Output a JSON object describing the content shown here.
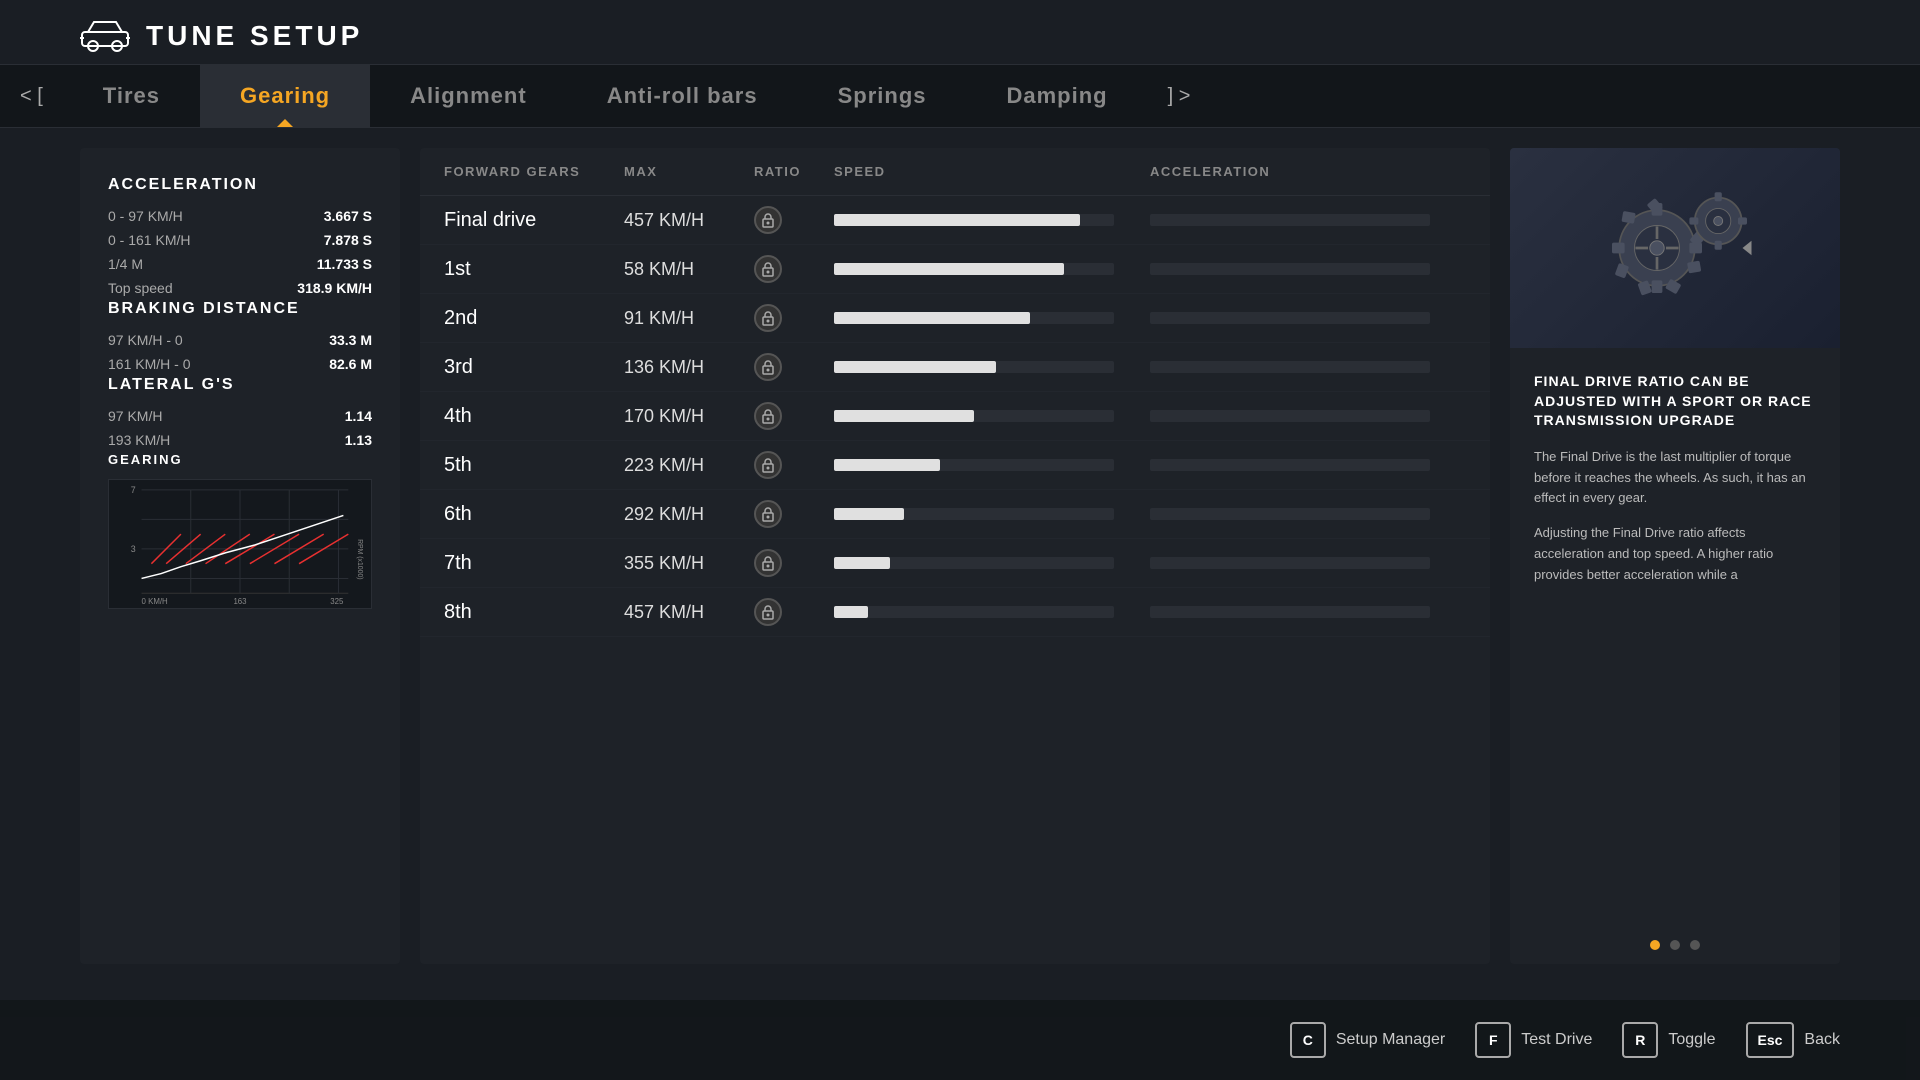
{
  "header": {
    "title": "TUNE SETUP"
  },
  "tabs": {
    "nav_left": "< [",
    "nav_right": "] >",
    "items": [
      {
        "id": "tires",
        "label": "Tires",
        "active": false
      },
      {
        "id": "gearing",
        "label": "Gearing",
        "active": true
      },
      {
        "id": "alignment",
        "label": "Alignment",
        "active": false
      },
      {
        "id": "antiroll",
        "label": "Anti-roll bars",
        "active": false
      },
      {
        "id": "springs",
        "label": "Springs",
        "active": false
      },
      {
        "id": "damping",
        "label": "Damping",
        "active": false
      }
    ]
  },
  "left_panel": {
    "sections": [
      {
        "title": "ACCELERATION",
        "rows": [
          {
            "label": "0 - 97 KM/H",
            "value": "3.667 S"
          },
          {
            "label": "0 - 161 KM/H",
            "value": "7.878 S"
          },
          {
            "label": "1/4 M",
            "value": "11.733 S"
          },
          {
            "label": "Top speed",
            "value": "318.9 KM/H"
          }
        ]
      },
      {
        "title": "BRAKING DISTANCE",
        "rows": [
          {
            "label": "97 KM/H - 0",
            "value": "33.3 M"
          },
          {
            "label": "161 KM/H - 0",
            "value": "82.6 M"
          }
        ]
      },
      {
        "title": "LATERAL G'S",
        "rows": [
          {
            "label": "97 KM/H",
            "value": "1.14"
          },
          {
            "label": "193 KM/H",
            "value": "1.13"
          }
        ]
      }
    ],
    "gearing_title": "GEARING",
    "chart": {
      "y_max": "7",
      "y_min": "3",
      "x_labels": [
        "0 KM/H",
        "163",
        "325"
      ],
      "rpm_label": "RPM (x1000)"
    }
  },
  "gearing_table": {
    "headers": [
      "FORWARD GEARS",
      "MAX",
      "RATIO",
      "SPEED",
      "ACCELERATION"
    ],
    "rows": [
      {
        "name": "Final drive",
        "max": "457 KM/H",
        "speed_pct": 88,
        "accel_pct": 0
      },
      {
        "name": "1st",
        "max": "58 KM/H",
        "speed_pct": 82,
        "accel_pct": 0
      },
      {
        "name": "2nd",
        "max": "91 KM/H",
        "speed_pct": 70,
        "accel_pct": 0
      },
      {
        "name": "3rd",
        "max": "136 KM/H",
        "speed_pct": 58,
        "accel_pct": 0
      },
      {
        "name": "4th",
        "max": "170 KM/H",
        "speed_pct": 50,
        "accel_pct": 0
      },
      {
        "name": "5th",
        "max": "223 KM/H",
        "speed_pct": 38,
        "accel_pct": 0
      },
      {
        "name": "6th",
        "max": "292 KM/H",
        "speed_pct": 25,
        "accel_pct": 0
      },
      {
        "name": "7th",
        "max": "355 KM/H",
        "speed_pct": 20,
        "accel_pct": 0
      },
      {
        "name": "8th",
        "max": "457 KM/H",
        "speed_pct": 12,
        "accel_pct": 0
      }
    ]
  },
  "right_panel": {
    "info_title": "FINAL DRIVE RATIO CAN BE ADJUSTED WITH A SPORT OR RACE TRANSMISSION UPGRADE",
    "info_body_1": "The Final Drive is the last multiplier of torque before it reaches the wheels. As such, it has an effect in every gear.",
    "info_body_2": "Adjusting the Final Drive ratio affects acceleration and top speed. A higher ratio provides better acceleration while a",
    "pagination": {
      "total": 3,
      "active": 0
    }
  },
  "bottom_bar": {
    "buttons": [
      {
        "key": "C",
        "label": "Setup Manager"
      },
      {
        "key": "F",
        "label": "Test Drive"
      },
      {
        "key": "R",
        "label": "Toggle"
      },
      {
        "key": "Esc",
        "label": "Back"
      }
    ]
  }
}
